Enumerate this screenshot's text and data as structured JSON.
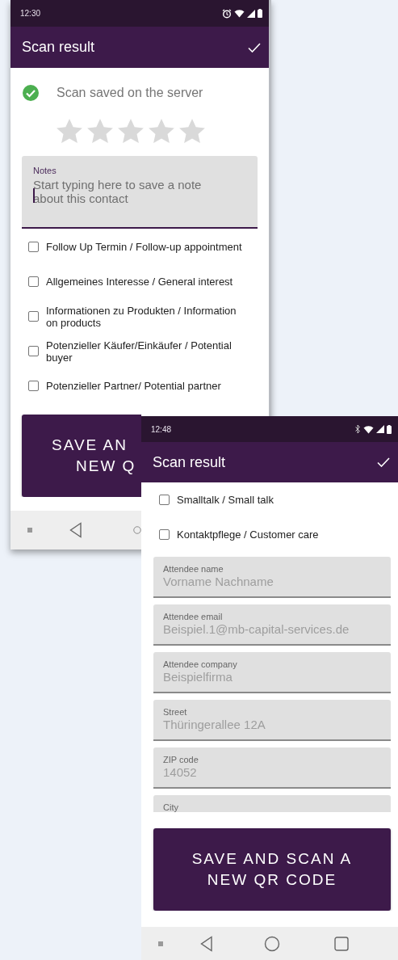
{
  "screens": [
    {
      "status_bar": {
        "time": "12:30"
      },
      "app_bar": {
        "title": "Scan result"
      },
      "status_message": "Scan saved on the server",
      "rating": {
        "stars": 0
      },
      "notes": {
        "label": "Notes",
        "placeholder": "Start typing here to save a note about this contact",
        "focused": true
      },
      "options": [
        {
          "label": "Follow Up Termin / Follow-up appointment",
          "checked": false
        },
        {
          "label": "Allgemeines Interesse / General interest",
          "checked": false
        },
        {
          "label": "Informationen zu Produkten / Information on products",
          "checked": false
        },
        {
          "label": "Potenzieller Käufer/Einkäufer / Potential buyer",
          "checked": false
        },
        {
          "label": "Potenzieller Partner/ Potential partner",
          "checked": false
        }
      ],
      "button": {
        "lines": [
          "SAVE AN",
          "NEW Q"
        ]
      }
    },
    {
      "status_bar": {
        "time": "12:48"
      },
      "app_bar": {
        "title": "Scan result"
      },
      "options": [
        {
          "label": "Smalltalk / Small talk",
          "checked": false
        },
        {
          "label": "Kontaktpflege / Customer care",
          "checked": false
        }
      ],
      "fields": [
        {
          "label": "Attendee name",
          "placeholder": "Vorname Nachname",
          "focused": false
        },
        {
          "label": "Attendee email",
          "placeholder": "Beispiel.1@mb-capital-services.de",
          "focused": false
        },
        {
          "label": "Attendee company",
          "placeholder": "Beispielfirma",
          "focused": false
        },
        {
          "label": "Street",
          "placeholder": "Thüringerallee 12A",
          "focused": false
        },
        {
          "label": "ZIP code",
          "placeholder": "14052",
          "focused": false
        },
        {
          "label": "City",
          "focused": false
        }
      ],
      "button": {
        "lines": [
          "SAVE AND SCAN A",
          "NEW QR CODE"
        ]
      }
    }
  ]
}
